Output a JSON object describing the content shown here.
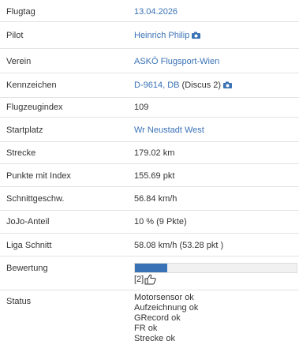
{
  "rows": [
    {
      "label": "Flugtag",
      "value": "13.04.2026"
    },
    {
      "label": "Pilot",
      "value": "Heinrich Philip"
    },
    {
      "label": "Verein",
      "value": "ASKÖ Flugsport-Wien"
    },
    {
      "label": "Kennzeichen",
      "value_link": "D-9614, DB",
      "value_rest": " (Discus 2)"
    },
    {
      "label": "Flugzeugindex",
      "value": "109"
    },
    {
      "label": "Startplatz",
      "value": "Wr Neustadt West"
    },
    {
      "label": "Strecke",
      "value": "179.02 km"
    },
    {
      "label": "Punkte mit Index",
      "value": "155.69 pkt"
    },
    {
      "label": "Schnittgeschw.",
      "value": "56.84 km/h"
    },
    {
      "label": "JoJo-Anteil",
      "value": "10 % (9 Pkte)"
    },
    {
      "label": "Liga Schnitt",
      "value": "58.08 km/h (53.28 pkt )"
    },
    {
      "label": "Bewertung",
      "rating_text": "[2]",
      "rating_fraction": 0.2
    },
    {
      "label": "Status",
      "lines": [
        "Motorsensor ok",
        "Aufzeichnung ok",
        "GRecord ok",
        "FR ok",
        "Strecke ok"
      ]
    }
  ],
  "icons": {
    "camera": "camera-icon",
    "thumb": "thumbs-up-icon"
  },
  "colors": {
    "link": "#3a72b6",
    "divider": "#e3e3e3",
    "rating_fill": "#3a72b6"
  }
}
